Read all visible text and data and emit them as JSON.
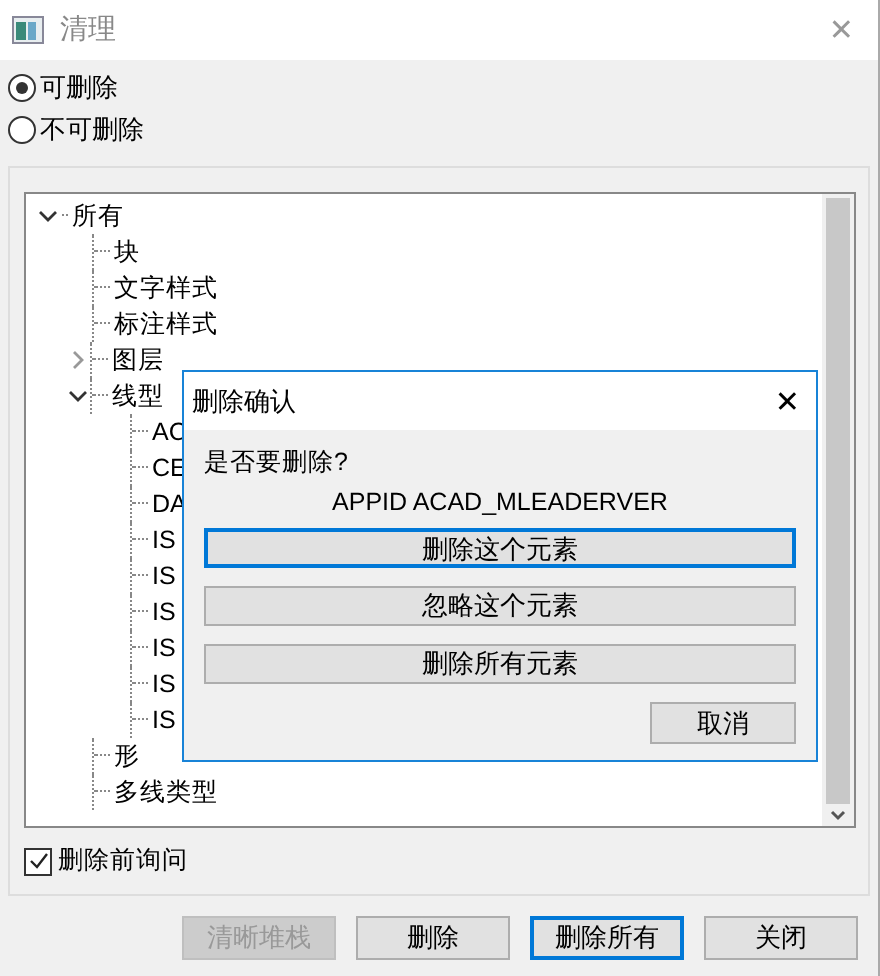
{
  "window": {
    "title": "清理",
    "close": "✕"
  },
  "scope": [
    {
      "label": "可删除",
      "selected": true
    },
    {
      "label": "不可删除",
      "selected": false
    }
  ],
  "tree": [
    {
      "label": "所有",
      "expanded": true,
      "children": [
        {
          "label": "块"
        },
        {
          "label": "文字样式"
        },
        {
          "label": "标注样式"
        },
        {
          "label": "图层",
          "expanded": false
        },
        {
          "label": "线型",
          "expanded": true,
          "children": [
            {
              "label": "AC"
            },
            {
              "label": "CE"
            },
            {
              "label": "DA"
            },
            {
              "label": "IS"
            },
            {
              "label": "IS"
            },
            {
              "label": "IS"
            },
            {
              "label": "IS"
            },
            {
              "label": "IS"
            },
            {
              "label": "IS"
            }
          ]
        },
        {
          "label": "形"
        },
        {
          "label": "多线类型"
        }
      ]
    }
  ],
  "confirm_before_delete": {
    "label": "删除前询问",
    "checked": true
  },
  "buttons": [
    {
      "label": "清晰堆栈",
      "disabled": true,
      "focused": false
    },
    {
      "label": "删除",
      "disabled": false,
      "focused": false
    },
    {
      "label": "删除所有",
      "disabled": false,
      "focused": true
    },
    {
      "label": "关闭",
      "disabled": false,
      "focused": false
    }
  ],
  "dialog": {
    "title": "删除确认",
    "close": "✕",
    "question": "是否要删除?",
    "item": "APPID ACAD_MLEADERVER",
    "actions": [
      {
        "label": "删除这个元素",
        "focused": true
      },
      {
        "label": "忽略这个元素",
        "focused": false
      },
      {
        "label": "删除所有元素",
        "focused": false
      }
    ],
    "cancel": "取消"
  }
}
